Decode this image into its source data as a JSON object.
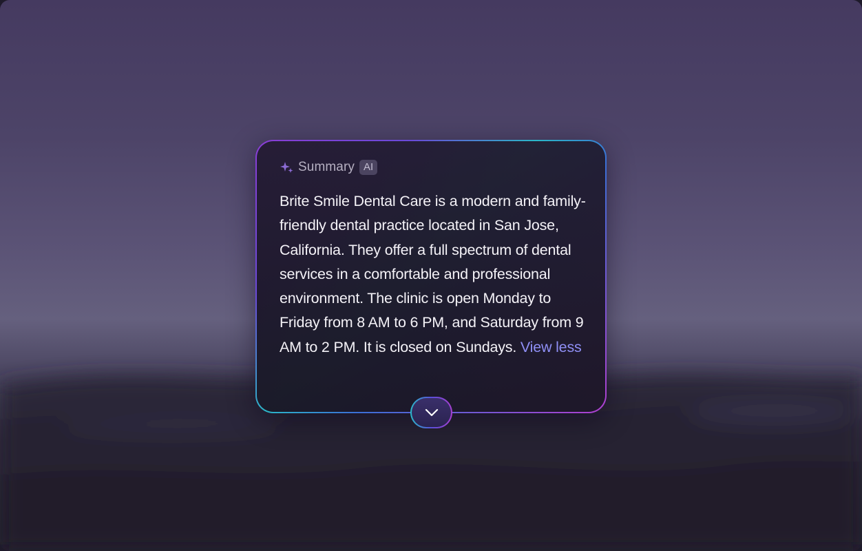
{
  "card": {
    "header": {
      "icon": "sparkle-icon",
      "title": "Summary",
      "badge": "AI"
    },
    "summary_text": "Brite Smile Dental Care is a modern and family-friendly dental practice located in San Jose, California. They offer a full spectrum of dental services in a comfortable and professional environment. The clinic is open Monday to Friday from 8 AM to 6 PM, and Saturday from 9 AM to 2 PM. It is closed on Sundays.",
    "view_less_label": "View less",
    "collapse_icon": "chevron-down-icon"
  },
  "colors": {
    "accent_link": "#8f8ff5",
    "border_gradient": [
      "#8a3dd6",
      "#2bb7c8",
      "#3b6fd6",
      "#b03fd0"
    ],
    "card_background": "#1e1a2b"
  }
}
